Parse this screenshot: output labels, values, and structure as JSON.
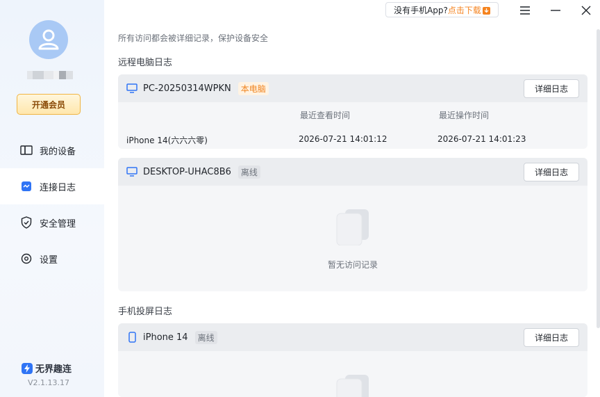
{
  "sidebar": {
    "vip_label": "开通会员",
    "nav": [
      {
        "label": "我的设备"
      },
      {
        "label": "连接日志"
      },
      {
        "label": "安全管理"
      },
      {
        "label": "设置"
      }
    ],
    "active_index": 1,
    "brand": "无界趣连",
    "version": "V2.1.13.17"
  },
  "topbar": {
    "promo_text": "没有手机App?",
    "promo_link": "点击下载"
  },
  "main": {
    "notice": "所有访问都会被详细记录，保护设备安全",
    "remote_title": "远程电脑日志",
    "mobile_title": "手机投屏日志",
    "detail_btn": "详细日志",
    "devices": [
      {
        "name": "PC-20250314WPKN",
        "tag": "本电脑",
        "col_view": "最近查看时间",
        "col_op": "最近操作时间",
        "log": {
          "client": "iPhone 14(六六六零)",
          "view_time": "2026-07-21 14:01:12",
          "op_time": "2026-07-21 14:01:23"
        }
      },
      {
        "name": "DESKTOP-UHAC8B6",
        "tag": "离线",
        "empty": "暂无访问记录"
      },
      {
        "name": "iPhone 14",
        "tag": "离线"
      }
    ]
  }
}
